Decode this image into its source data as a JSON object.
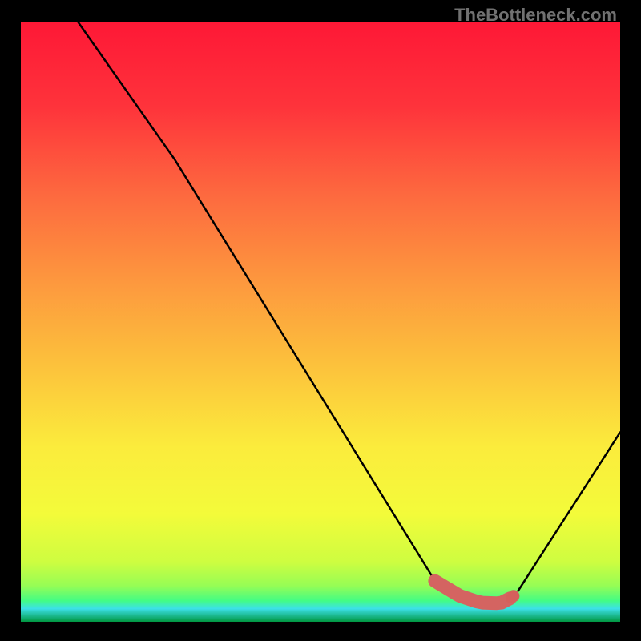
{
  "attribution": "TheBottleneck.com",
  "colors": {
    "gradient_stops": [
      {
        "offset": 0.0,
        "color": "#fe1836"
      },
      {
        "offset": 0.14,
        "color": "#fe333b"
      },
      {
        "offset": 0.29,
        "color": "#fd6a3f"
      },
      {
        "offset": 0.43,
        "color": "#fd973e"
      },
      {
        "offset": 0.57,
        "color": "#fcc13c"
      },
      {
        "offset": 0.71,
        "color": "#fbec3c"
      },
      {
        "offset": 0.82,
        "color": "#f3fb3a"
      },
      {
        "offset": 0.9,
        "color": "#cefd40"
      },
      {
        "offset": 0.94,
        "color": "#96fd55"
      },
      {
        "offset": 0.965,
        "color": "#43fc85"
      },
      {
        "offset": 0.978,
        "color": "#3ce0e8"
      },
      {
        "offset": 1.0,
        "color": "#009741"
      }
    ],
    "curve": "#000000",
    "valley_stroke": "#d46461",
    "valley_fill": "#d5605c"
  },
  "chart_data": {
    "type": "line",
    "title": "",
    "xlabel": "",
    "ylabel": "",
    "xlim": [
      0,
      100
    ],
    "ylim": [
      0,
      100
    ],
    "series": [
      {
        "name": "bottleneck-curve",
        "x": [
          9.6,
          25.7,
          69.1,
          72.6,
          73.3,
          76.0,
          77.0,
          79.3,
          80.2,
          81.6,
          82.2,
          83.0,
          100.0
        ],
        "y": [
          100.0,
          77.1,
          6.8,
          4.7,
          4.3,
          3.4,
          3.2,
          3.1,
          3.2,
          3.9,
          4.3,
          5.2,
          31.6
        ]
      }
    ],
    "valley_markers": {
      "x": [
        69.1,
        72.6,
        73.3,
        76.0,
        77.0,
        79.3,
        80.2,
        81.6,
        82.2
      ],
      "y": [
        6.8,
        4.7,
        4.3,
        3.4,
        3.2,
        3.1,
        3.2,
        3.9,
        4.3
      ]
    }
  }
}
